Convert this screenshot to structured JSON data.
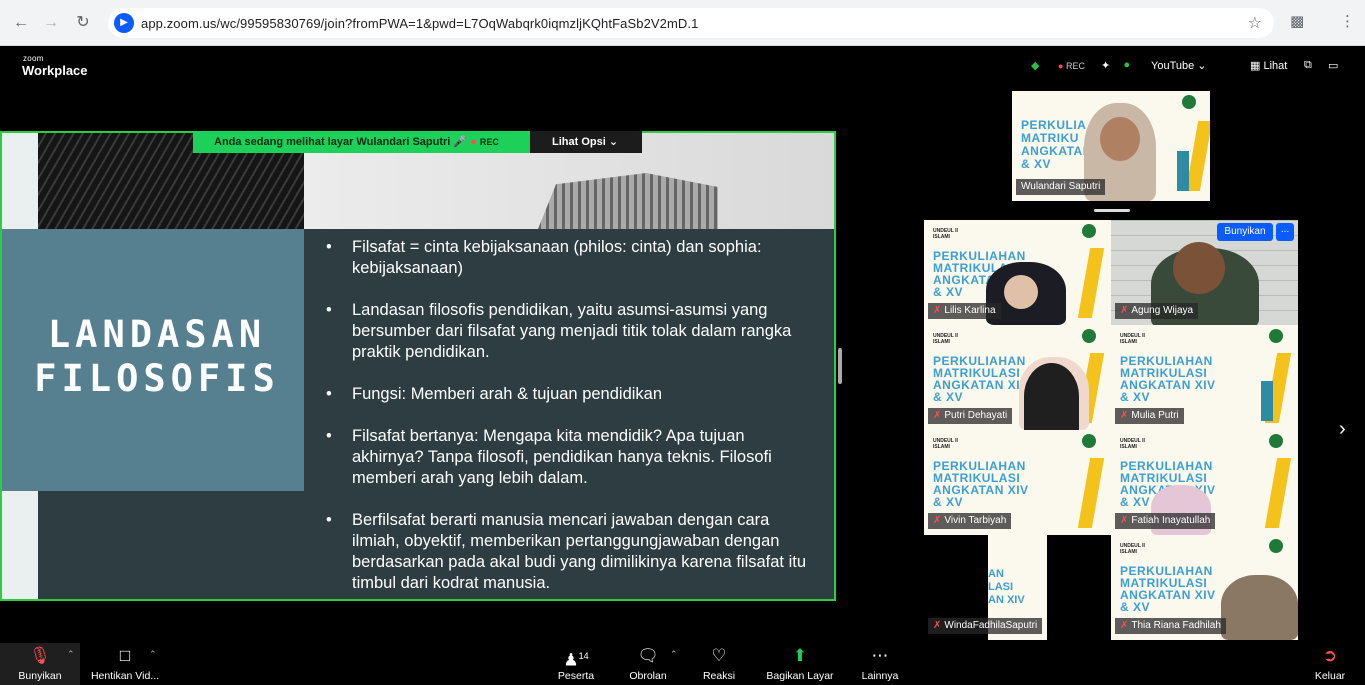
{
  "browser": {
    "url": "app.zoom.us/wc/99595830769/join?fromPWA=1&pwd=L7OqWabqrk0iqmzljKQhtFaSb2V2mD.1",
    "back_icon": "arrow-left",
    "forward_icon": "arrow-right",
    "reload_icon": "reload",
    "star_icon": "star",
    "extensions_icon": "puzzle",
    "menu_icon": "kebab"
  },
  "zoom_header": {
    "logo_top": "zoom",
    "logo_bottom": "Workplace",
    "rec": "REC",
    "youtube": "YouTube",
    "view": "Lihat"
  },
  "share": {
    "banner_text": "Anda sedang melihat layar  Wulandari Saputri",
    "banner_rec": "REC",
    "view_options": "Lihat Opsi"
  },
  "slide": {
    "title_line1": "LANDASAN",
    "title_line2": "FILOSOFIS",
    "bullets": [
      "Filsafat = cinta kebijaksanaan (philos: cinta) dan sophia: kebijaksanaan)",
      "Landasan filosofis pendidikan, yaitu asumsi-asumsi yang bersumber dari filsafat yang menjadi titik tolak dalam rangka praktik pendidikan.",
      "Fungsi: Memberi arah & tujuan pendidikan",
      "Filsafat bertanya: Mengapa kita mendidik? Apa tujuan akhirnya? Tanpa filosofi, pendidikan hanya teknis. Filosofi memberi arah yang lebih dalam.",
      "Berfilsafat berarti manusia mencari jawaban dengan cara ilmiah, obyektif, memberikan pertanggungjawaban dengan berdasarkan pada akal budi yang dimilikinya karena filsafat itu timbul dari kodrat manusia."
    ]
  },
  "participants": {
    "speaker": "Wulandari Saputri",
    "unmute_label": "Bunyikan",
    "more_label": "...",
    "tiles": [
      {
        "name": "Lilis Karlina"
      },
      {
        "name": "Agung Wijaya"
      },
      {
        "name": "Putri Dehayati"
      },
      {
        "name": "Mulia Putri"
      },
      {
        "name": "Vivin Tarbiyah"
      },
      {
        "name": "Fatiah Inayatullah"
      },
      {
        "name": "WindaFadhilaSaputri"
      },
      {
        "name": "Thia Riana Fadhilah"
      }
    ],
    "slide_thumb_head": "UNDEUL II\nISLAMI",
    "slide_thumb_text": "PERKULIAHAN\nMATRIKULASI\nANGKATAN XIV\n& XV",
    "speaker_thumb_text": "PERKULIA\nMATRIKU\nANGKATAN\n& XV"
  },
  "toolbar": {
    "mute": "Bunyikan",
    "video": "Hentikan Vid...",
    "participants": "Peserta",
    "participants_count": "14",
    "chat": "Obrolan",
    "reactions": "Reaksi",
    "share": "Bagikan Layar",
    "more": "Lainnya",
    "leave": "Keluar"
  },
  "colors": {
    "share_border": "#2ecc40",
    "banner": "#1dd05a",
    "slide_bg": "#2d3d42",
    "slide_teal": "#56808f",
    "zoom_blue": "#0b5cff"
  }
}
